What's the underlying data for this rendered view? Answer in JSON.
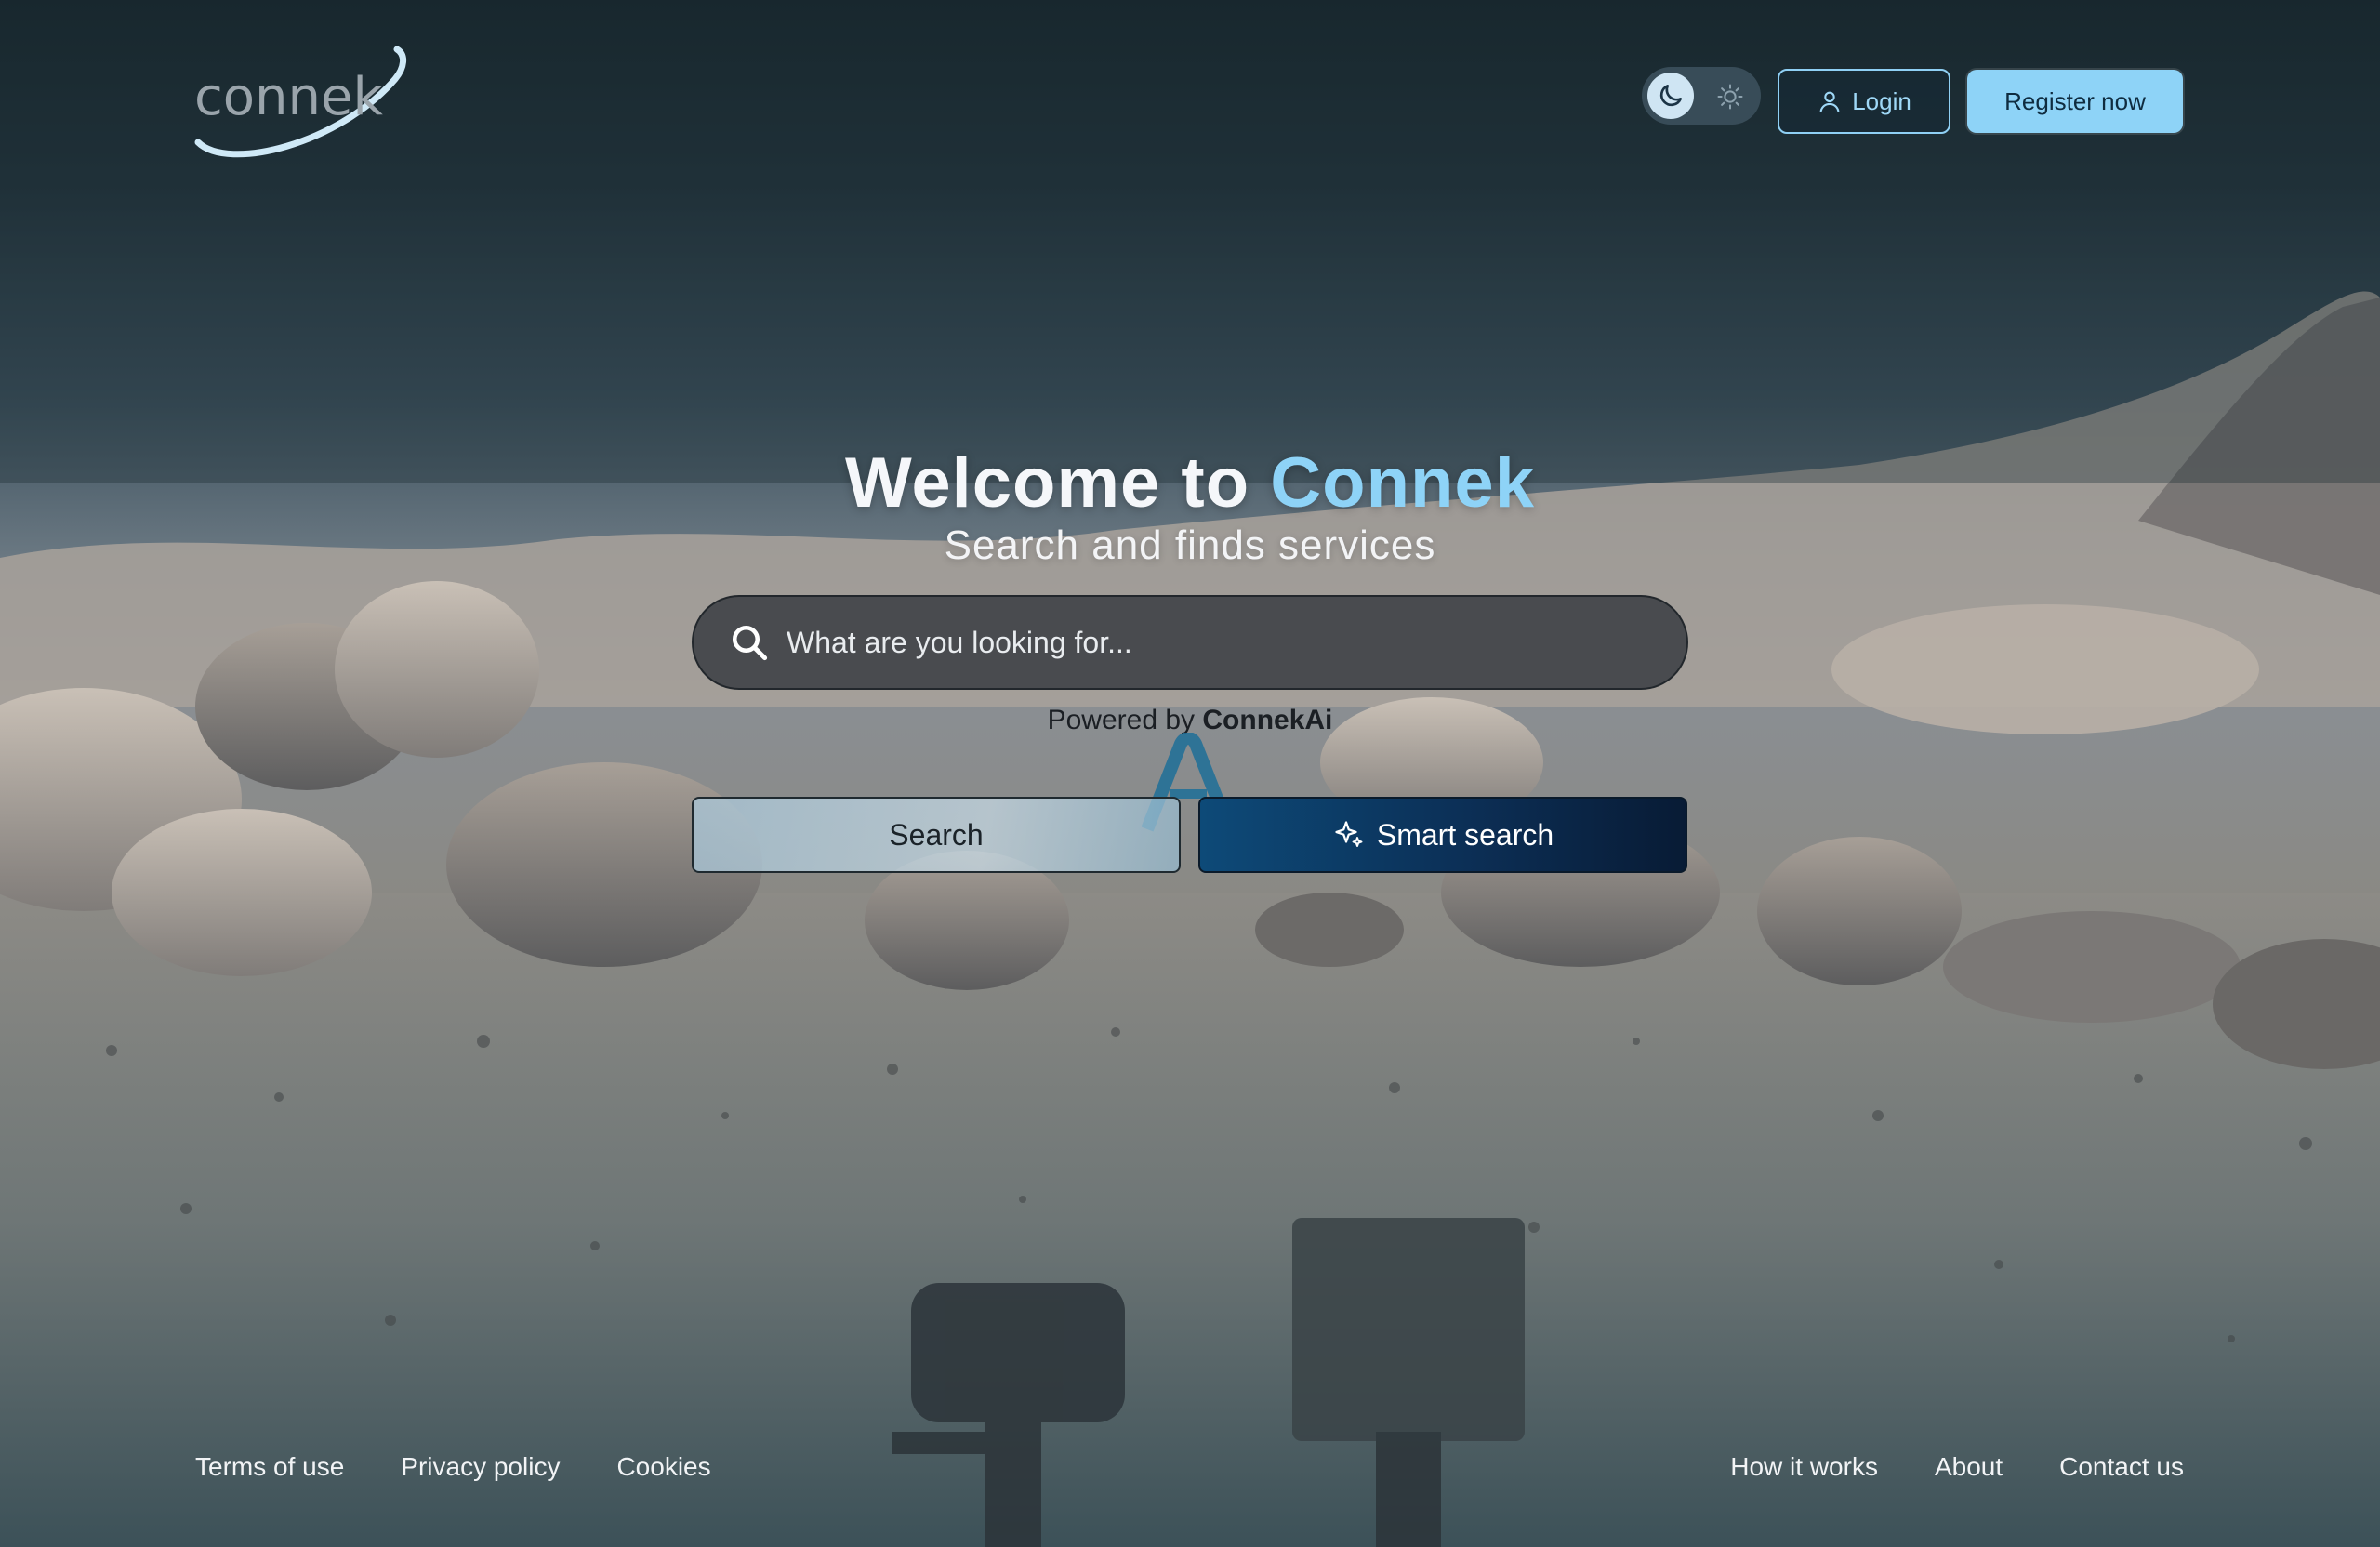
{
  "header": {
    "logo_text": "connek",
    "theme_toggle": {
      "active": "dark",
      "moon_icon": "moon-icon",
      "sun_icon": "sun-icon"
    },
    "login_label": "Login",
    "register_label": "Register now"
  },
  "hero": {
    "title_prefix": "Welcome to",
    "title_accent": "Connek",
    "subtitle": "Search and finds services"
  },
  "search": {
    "placeholder": "What are you looking for...",
    "value": ""
  },
  "powered": {
    "prefix": "Powered by",
    "brand": "ConnekAi"
  },
  "actions": {
    "search_label": "Search",
    "smart_search_label": "Smart search"
  },
  "footer": {
    "left": [
      "Terms of use",
      "Privacy policy",
      "Cookies"
    ],
    "right": [
      "How it works",
      "About",
      "Contact us"
    ]
  },
  "colors": {
    "accent": "#8ed3f7",
    "smart_search_bg": "#0c2f56",
    "text_light": "#f5f7fa"
  }
}
